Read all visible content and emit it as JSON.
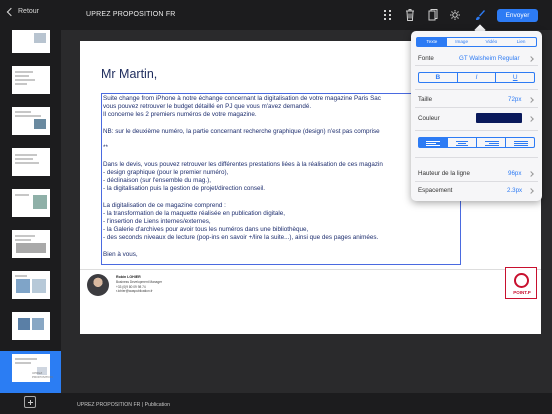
{
  "topbar": {
    "back_label": "Retour",
    "title": "UPREZ PROPOSITION FR",
    "send_label": "Envoyer",
    "icons": [
      "grid-icon",
      "trash-icon",
      "copy-icon",
      "settings-icon",
      "brush-icon"
    ]
  },
  "sidebar": {
    "thumbnails": [
      {
        "num": "",
        "label": ""
      },
      {
        "num": "",
        "label": "UPREZ PROPOSITION"
      },
      {
        "num": "",
        "label": "UPREZ PROPOSITION"
      },
      {
        "num": "",
        "label": "UPREZ PROPOSITION"
      },
      {
        "num": "",
        "label": ""
      },
      {
        "num": "",
        "label": ""
      },
      {
        "num": "",
        "label": ""
      },
      {
        "num": "",
        "label": ""
      },
      {
        "num": "",
        "label": "UPREZ PROPOSITION"
      },
      {
        "num": "",
        "label": "UPREZ PROPOSITION"
      }
    ],
    "active_index": 9
  },
  "document": {
    "greeting": "Mr Martin,",
    "lines": [
      "Suite change from iPhone à notre échange concernant la digitalisation de votre magazine Paris Sac",
      "vous pouvez retrouver le budget détaillé en PJ que vous m'avez demandé.",
      "Il concerne les 2 premiers numéros de votre magazine.",
      "",
      "NB: sur le deuxième numéro, la partie concernant recherche graphique (design) n'est pas comprise",
      "",
      "**",
      "",
      "Dans le devis, vous pouvez retrouver les différentes prestations liées à la réalisation de ces magazin",
      "- design graphique (pour le premier numéro),",
      "- déclinaison (sur l'ensemble du mag.),",
      "- la digitalisation puis la gestion de projet/direction conseil.",
      "",
      "La digitalisation de ce magazine comprend :",
      "- la transformation de la maquette réalisée en publication digitale,",
      "- l'insertion de Liens internes/externes,",
      "- la Galerie d'archives pour avoir tous les numéros dans une bibliothèque,",
      "- des seconds niveaux de lecture (pop-ins en savoir +/lire la suite...), ainsi que des pages animées.",
      "",
      "Bien à vous,"
    ],
    "signature": {
      "name": "Robin LOHIER",
      "role": "Business Development Manager",
      "phone": "+33 (0)9 80 09 98 74",
      "email": "r.lohier@waspublication.fr"
    },
    "logo_text": "POINT.P"
  },
  "bottombar": {
    "text": "UPREZ PROPOSITION FR  |  Publication"
  },
  "panel": {
    "tabs": [
      "Texte",
      "Image",
      "Vidéo",
      "Lien"
    ],
    "active_tab": "Texte",
    "font_label": "Fonte",
    "font_value": "GT Walsheim Regular",
    "style_buttons": [
      "B",
      "I",
      "U"
    ],
    "size_label": "Taille",
    "size_value": "72px",
    "color_label": "Couleur",
    "color_value": "#0a1a5c",
    "line_height_label": "Hauteur de la ligne",
    "line_height_value": "96px",
    "spacing_label": "Espacement",
    "spacing_value": "2.3px"
  },
  "colors": {
    "accent": "#2d7bf4",
    "text_navy": "#1e2e6e"
  }
}
